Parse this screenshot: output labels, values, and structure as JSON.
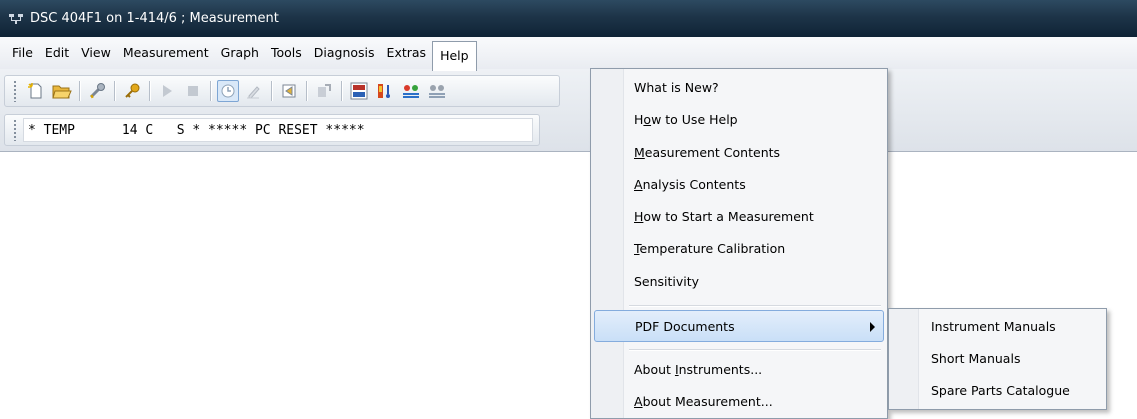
{
  "window": {
    "title": "DSC 404F1 on 1-414/6 ; Measurement"
  },
  "menubar": {
    "items": [
      "File",
      "Edit",
      "View",
      "Measurement",
      "Graph",
      "Tools",
      "Diagnosis",
      "Extras",
      "Help"
    ]
  },
  "toolbar": {
    "buttons": [
      "new-file-icon",
      "open-folder-icon",
      "wrench-icon",
      "key-icon",
      "play-icon",
      "stop-icon",
      "clock-icon",
      "pencil-icon",
      "back-icon",
      "export-icon",
      "binary-display-icon",
      "temperature-bar-icon",
      "sensors-color-icon",
      "sensors-gray-icon"
    ]
  },
  "status": {
    "text": "* TEMP      14 C   S * ***** PC RESET *****"
  },
  "help_menu": {
    "items": [
      {
        "pre": "What is New?",
        "u": "",
        "post": ""
      },
      {
        "pre": "H",
        "u": "o",
        "post": "w to Use Help"
      },
      {
        "pre": "",
        "u": "M",
        "post": "easurement Contents"
      },
      {
        "pre": "",
        "u": "A",
        "post": "nalysis Contents"
      },
      {
        "pre": "",
        "u": "H",
        "post": "ow to Start a Measurement"
      },
      {
        "pre": "",
        "u": "T",
        "post": "emperature Calibration"
      },
      {
        "pre": "Sensitivity",
        "u": "",
        "post": ""
      },
      {
        "pre": "PDF Documents",
        "u": "",
        "post": ""
      },
      {
        "pre": "About ",
        "u": "I",
        "post": "nstruments..."
      },
      {
        "pre": "",
        "u": "A",
        "post": "bout Measurement..."
      }
    ]
  },
  "pdf_submenu": {
    "items": [
      "Instrument Manuals",
      "Short Manuals",
      "Spare Parts Catalogue"
    ]
  },
  "colors": {
    "titlebar": "#1d3448",
    "highlight": "#c9dff7",
    "highlight_border": "#84acdd"
  }
}
